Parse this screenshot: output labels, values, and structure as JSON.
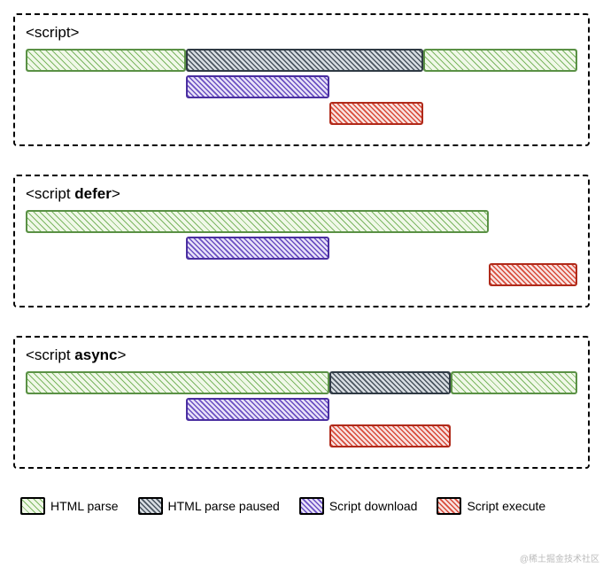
{
  "chart_data": [
    {
      "type": "bar",
      "title": "<script>",
      "xlim": [
        0,
        100
      ],
      "unit": "% of total timeline",
      "series": [
        {
          "name": "HTML parse",
          "segments": [
            [
              0,
              29
            ],
            [
              72,
              100
            ]
          ],
          "row": 0
        },
        {
          "name": "HTML parse paused",
          "segments": [
            [
              29,
              72
            ]
          ],
          "row": 0
        },
        {
          "name": "Script download",
          "segments": [
            [
              29,
              55
            ]
          ],
          "row": 1
        },
        {
          "name": "Script execute",
          "segments": [
            [
              55,
              72
            ]
          ],
          "row": 2
        }
      ]
    },
    {
      "type": "bar",
      "title": "<script defer>",
      "xlim": [
        0,
        100
      ],
      "unit": "% of total timeline",
      "series": [
        {
          "name": "HTML parse",
          "segments": [
            [
              0,
              84
            ]
          ],
          "row": 0
        },
        {
          "name": "Script download",
          "segments": [
            [
              29,
              55
            ]
          ],
          "row": 1
        },
        {
          "name": "Script execute",
          "segments": [
            [
              84,
              100
            ]
          ],
          "row": 2
        }
      ]
    },
    {
      "type": "bar",
      "title": "<script async>",
      "xlim": [
        0,
        100
      ],
      "unit": "% of total timeline",
      "series": [
        {
          "name": "HTML parse",
          "segments": [
            [
              0,
              55
            ],
            [
              77,
              100
            ]
          ],
          "row": 0
        },
        {
          "name": "HTML parse paused",
          "segments": [
            [
              55,
              77
            ]
          ],
          "row": 0
        },
        {
          "name": "Script download",
          "segments": [
            [
              29,
              55
            ]
          ],
          "row": 1
        },
        {
          "name": "Script execute",
          "segments": [
            [
              55,
              77
            ]
          ],
          "row": 2
        }
      ]
    }
  ],
  "panels": [
    {
      "title_plain": "<script",
      "title_bold": "",
      "title_close": ">"
    },
    {
      "title_plain": "<script ",
      "title_bold": "defer",
      "title_close": ">"
    },
    {
      "title_plain": "<script ",
      "title_bold": "async",
      "title_close": ">"
    }
  ],
  "legend": {
    "items": [
      {
        "label": "HTML parse",
        "class": "hatch-green"
      },
      {
        "label": "HTML parse paused",
        "class": "hatch-slate"
      },
      {
        "label": "Script download",
        "class": "hatch-purple"
      },
      {
        "label": "Script execute",
        "class": "hatch-red"
      }
    ]
  },
  "watermark": "@稀土掘金技术社区",
  "class_map": {
    "HTML parse": "hatch-green",
    "HTML parse paused": "hatch-slate",
    "Script download": "hatch-purple",
    "Script execute": "hatch-red"
  }
}
